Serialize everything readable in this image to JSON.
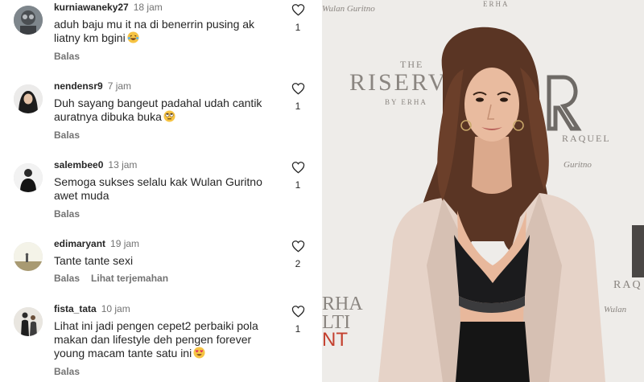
{
  "comments": [
    {
      "username": "kurniawaneky27",
      "time": "18 jam",
      "text": "aduh  baju mu it na di benerrin  pusing ak liatny km bgini",
      "emoji": "laughing-tears-emoji",
      "likes": "1",
      "reply_label": "Balas"
    },
    {
      "username": "nendensr9",
      "time": "7 jam",
      "text": "Duh sayang bangeut padahal udah cantik auratnya dibuka buka",
      "emoji": "eye-roll-emoji",
      "likes": "1",
      "reply_label": "Balas"
    },
    {
      "username": "salembee0",
      "time": "13 jam",
      "text": "Semoga sukses selalu kak Wulan Guritno awet muda",
      "likes": "1",
      "reply_label": "Balas"
    },
    {
      "username": "edimaryant",
      "time": "19 jam",
      "text": "Tante tante sexi",
      "likes": "2",
      "reply_label": "Balas",
      "translate_label": "Lihat terjemahan"
    },
    {
      "username": "fista_tata",
      "time": "10 jam",
      "text": "Lihat ini jadi pengen cepet2 perbaiki pola makan dan lifestyle deh pengen forever young macam tante satu ini",
      "emoji": "heart-eyes-emoji",
      "likes": "1",
      "reply_label": "Balas"
    }
  ],
  "photo": {
    "backdrop_text": [
      "THE",
      "RISERVA",
      "BY ERHA",
      "RAQUEL",
      "RHA",
      "LTI",
      "NT",
      "RAQ",
      "Wulan",
      "Guritno",
      "ERHA",
      "Wulan Guritno"
    ],
    "colors": {
      "backdrop": "#eeece9",
      "hair": "#5a3524",
      "blazer": "#e6d3c8",
      "top": "#1b1b1d",
      "skin": "#e8b89c"
    }
  },
  "colors": {
    "text": "#262626",
    "secondary": "#737373"
  }
}
